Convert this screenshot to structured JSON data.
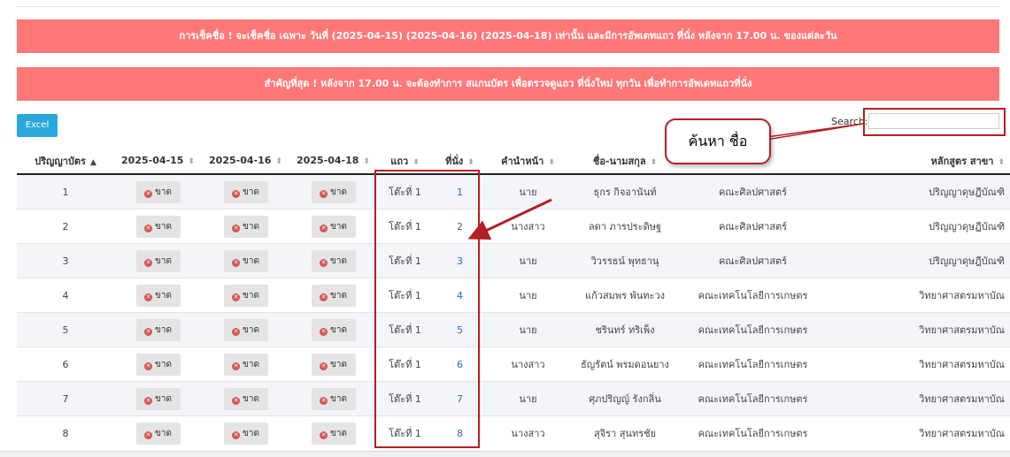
{
  "alerts": {
    "first": "การเช็คชื่อ ! จะเช็คชื่อ เฉพาะ วันที่ (2025-04-15) (2025-04-16) (2025-04-18) เท่านั้น และมีการอัพเดทแถว ที่นั่ง หลังจาก 17.00 น. ของแต่ละวัน",
    "second": "สำคัญที่สุด ! หลังจาก 17.00 น. จะต้องทำการ สแกนบัตร เพื่อตรวจดูแถว ที่นั่งใหม่ ทุกวัน เพื่อทำการอัพเดทแถวที่นั่ง"
  },
  "toolbar": {
    "excel_label": "Excel"
  },
  "search": {
    "label": "Search:",
    "value": ""
  },
  "annotation": {
    "callout_text": "ค้นหา ชื่อ"
  },
  "table": {
    "headers": [
      "ปริญญาบัตร",
      "2025-04-15",
      "2025-04-16",
      "2025-04-18",
      "แถว",
      "ที่นั่ง",
      "คำนำหน้า",
      "ชื่อ-นามสกุล",
      "",
      "หลักสูตร สาขา"
    ],
    "absent_label": "ขาด",
    "rows": [
      {
        "no": "1",
        "row": "โต๊ะที่ 1",
        "seat": "1",
        "prefix": "นาย",
        "name": "ธุกร กิจอานันท์",
        "faculty": "คณะศิลปศาสตร์",
        "program": "ปริญญาดุษฎีบัณฑิ"
      },
      {
        "no": "2",
        "row": "โต๊ะที่ 1",
        "seat": "2",
        "prefix": "นางสาว",
        "name": "ลดา ภารประดิษฐ",
        "faculty": "คณะศิลปศาสตร์",
        "program": "ปริญญาดุษฎีบัณฑิ"
      },
      {
        "no": "3",
        "row": "โต๊ะที่ 1",
        "seat": "3",
        "prefix": "นาย",
        "name": "วิวรรธน์ พุทธานุ",
        "faculty": "คณะศิลปศาสตร์",
        "program": "ปริญญาดุษฎีบัณฑิ"
      },
      {
        "no": "4",
        "row": "โต๊ะที่ 1",
        "seat": "4",
        "prefix": "นาย",
        "name": "แก้วสมพร พันทะวง",
        "faculty": "คณะเทคโนโลยีการเกษตร",
        "program": "วิทยาศาสตรมหาบัณ"
      },
      {
        "no": "5",
        "row": "โต๊ะที่ 1",
        "seat": "5",
        "prefix": "นาย",
        "name": "ชรินทร์ ทริเพ็ง",
        "faculty": "คณะเทคโนโลยีการเกษตร",
        "program": "วิทยาศาสตรมหาบัณ"
      },
      {
        "no": "6",
        "row": "โต๊ะที่ 1",
        "seat": "6",
        "prefix": "นางสาว",
        "name": "ธัญรัตน์ พรมดอนยาง",
        "faculty": "คณะเทคโนโลยีการเกษตร",
        "program": "วิทยาศาสตรมหาบัณ"
      },
      {
        "no": "7",
        "row": "โต๊ะที่ 1",
        "seat": "7",
        "prefix": "นาย",
        "name": "ศุภปริญญ์ รังกลิ่น",
        "faculty": "คณะเทคโนโลยีการเกษตร",
        "program": "วิทยาศาสตรมหาบัณ"
      },
      {
        "no": "8",
        "row": "โต๊ะที่ 1",
        "seat": "8",
        "prefix": "นางสาว",
        "name": "สุจิรา สุนทรชัย",
        "faculty": "คณะเทคโนโลยีการเกษตร",
        "program": "วิทยาศาสตรมหาบัณ"
      }
    ]
  },
  "colors": {
    "alert_bg": "#ff7777",
    "excel_bg": "#2aa7dc",
    "annotation_red": "#b31f24",
    "link": "#2a6fb0"
  }
}
